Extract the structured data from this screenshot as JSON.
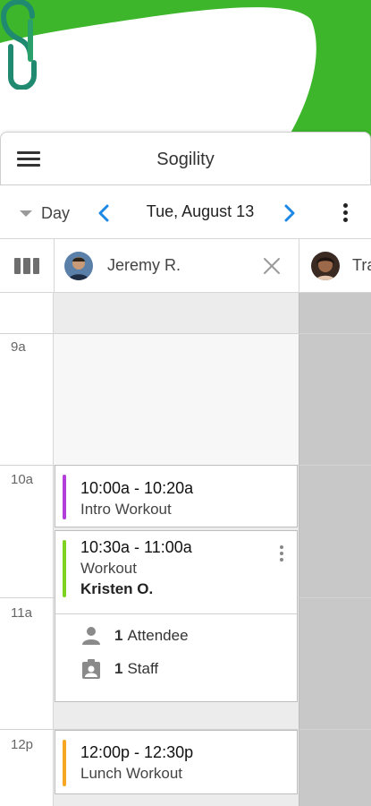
{
  "app": {
    "title": "Sogility",
    "brand_color": "#3db62c",
    "logo_color": "#1f8a70",
    "icons": {
      "menu": "menu-icon",
      "logo": "sogility-logo"
    }
  },
  "toolbar": {
    "view_label": "Day",
    "date_label": "Tue, August 13",
    "accent_color": "#1e88e5",
    "icons": {
      "view": "dropdown-caret-icon",
      "prev": "chevron-left-icon",
      "next": "chevron-right-icon",
      "more": "more-vertical-icon"
    }
  },
  "staff": [
    {
      "name": "Jeremy R.",
      "icon": "avatar"
    },
    {
      "name": "Tra",
      "icon": "avatar"
    }
  ],
  "hours": [
    "9a",
    "10a",
    "11a",
    "12p"
  ],
  "events": [
    {
      "time": "10:00a - 10:20a",
      "name": "Intro Workout",
      "color": "#b23fd9"
    },
    {
      "time": "10:30a - 11:00a",
      "name": "Workout",
      "client": "Kristen O.",
      "color": "#7ed321",
      "attendees": {
        "count": "1",
        "label": "Attendee",
        "icon": "person-icon"
      },
      "staff": {
        "count": "1",
        "label": "Staff",
        "icon": "staff-badge-icon"
      }
    },
    {
      "time": "12:00p - 12:30p",
      "name": "Lunch Workout",
      "color": "#f5a623"
    }
  ]
}
